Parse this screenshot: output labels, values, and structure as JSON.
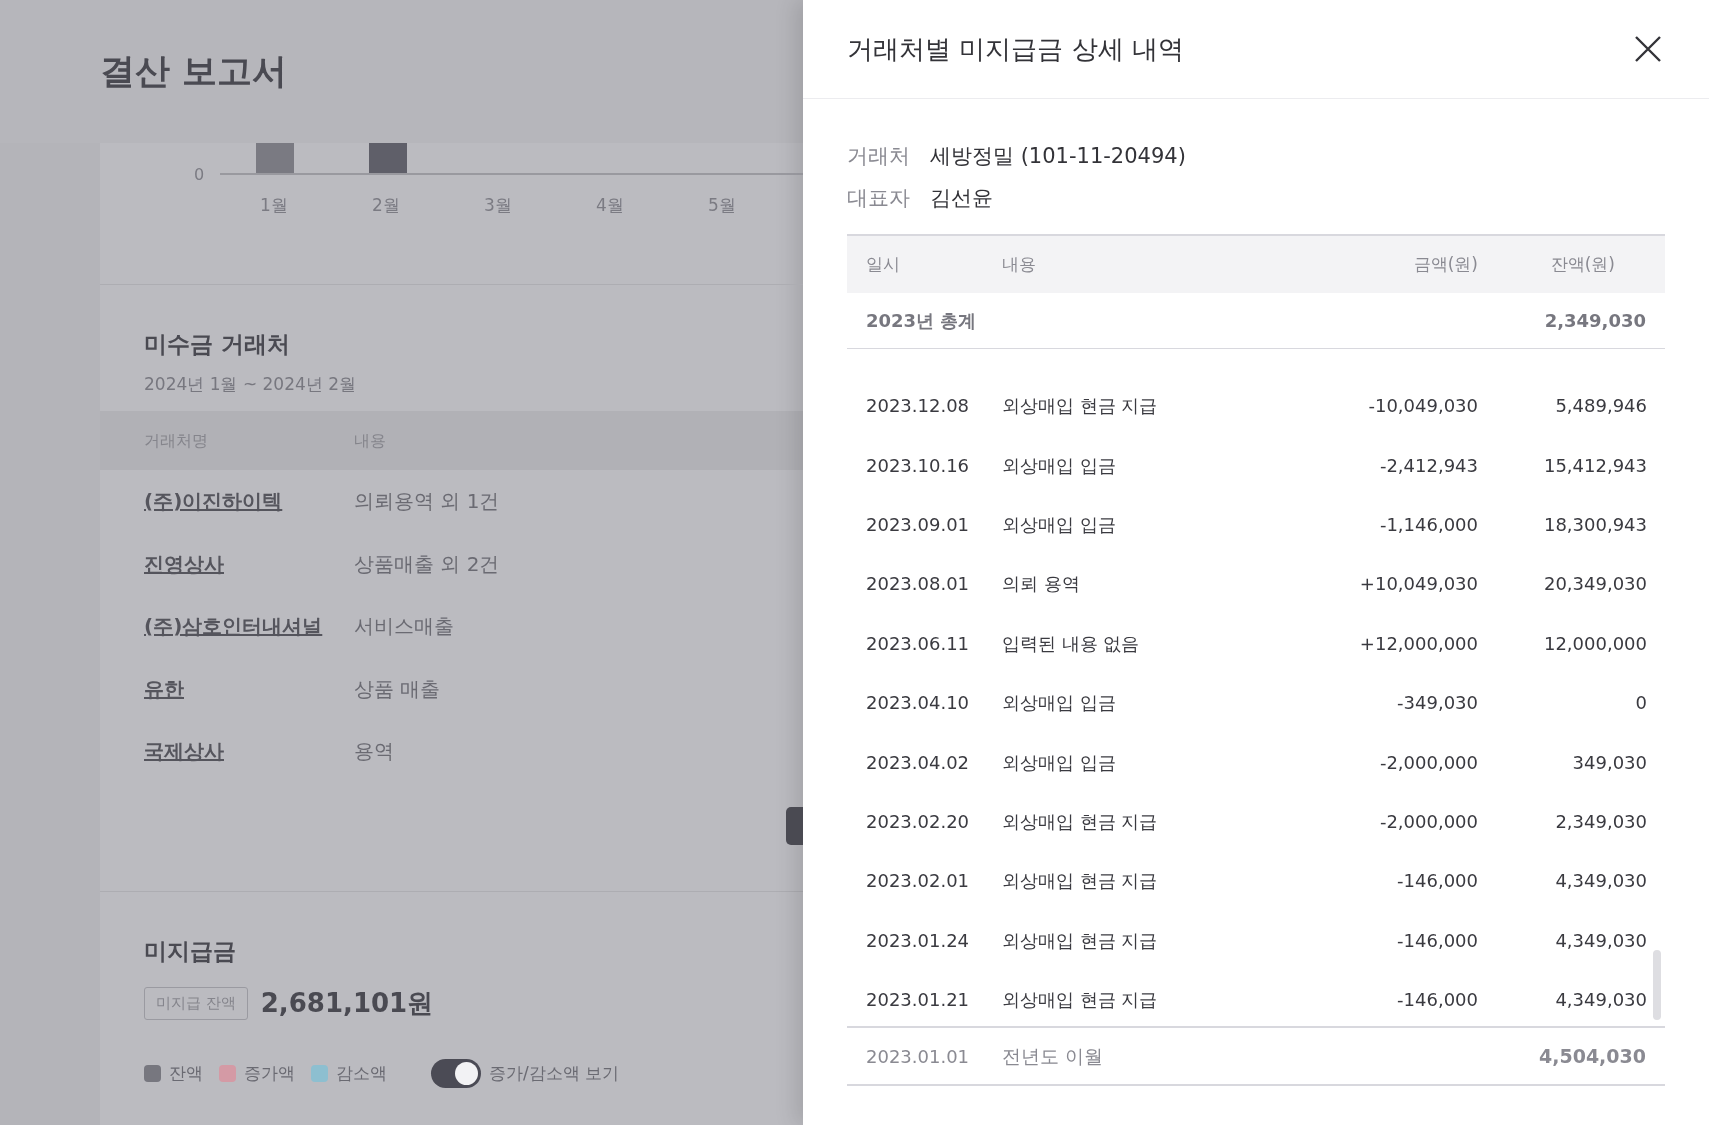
{
  "page": {
    "title": "결산 보고서"
  },
  "chart_axis": {
    "zero_label": "0",
    "months": [
      "1월",
      "2월",
      "3월",
      "4월",
      "5월"
    ]
  },
  "receivables": {
    "title": "미수금 거래처",
    "period": "2024년 1월 ~ 2024년 2월",
    "columns": [
      "거래처명",
      "내용"
    ],
    "rows": [
      {
        "name": "(주)이진하이텍",
        "content": "의뢰용역 외 1건"
      },
      {
        "name": "진영상사",
        "content": "상품매출 외 2건"
      },
      {
        "name": "(주)삼호인터내셔널",
        "content": "서비스매출"
      },
      {
        "name": "유한",
        "content": "상품 매출"
      },
      {
        "name": "국제상사",
        "content": "용역"
      }
    ]
  },
  "payables": {
    "title": "미지급금",
    "balance_label": "미지급 잔액",
    "balance": "2,681,101원",
    "legend": [
      {
        "label": "잔액",
        "color": "#77777f"
      },
      {
        "label": "증가액",
        "color": "#d49aa5"
      },
      {
        "label": "감소액",
        "color": "#8dbfd0"
      }
    ],
    "toggle": {
      "label": "증가/감소액 보기",
      "on": true
    }
  },
  "drawer": {
    "title": "거래처별 미지급금 상세 내역",
    "info": [
      {
        "label": "거래처",
        "value": "세방정밀 (101-11-20494)"
      },
      {
        "label": "대표자",
        "value": "김선윤"
      }
    ],
    "columns": [
      "일시",
      "내용",
      "금액(원)",
      "잔액(원)"
    ],
    "summary": {
      "label": "2023년 총계",
      "balance": "2,349,030"
    },
    "rows": [
      {
        "date": "2023.12.08",
        "content": "외상매입 현금 지급",
        "amount": "-10,049,030",
        "balance": "5,489,946"
      },
      {
        "date": "2023.10.16",
        "content": "외상매입 입금",
        "amount": "-2,412,943",
        "balance": "15,412,943"
      },
      {
        "date": "2023.09.01",
        "content": "외상매입 입금",
        "amount": "-1,146,000",
        "balance": "18,300,943"
      },
      {
        "date": "2023.08.01",
        "content": "의뢰 용역",
        "amount": "+10,049,030",
        "balance": "20,349,030"
      },
      {
        "date": "2023.06.11",
        "content": "입력된 내용 없음",
        "amount": "+12,000,000",
        "balance": "12,000,000"
      },
      {
        "date": "2023.04.10",
        "content": "외상매입 입금",
        "amount": "-349,030",
        "balance": "0"
      },
      {
        "date": "2023.04.02",
        "content": "외상매입 입금",
        "amount": "-2,000,000",
        "balance": "349,030"
      },
      {
        "date": "2023.02.20",
        "content": "외상매입 현금 지급",
        "amount": "-2,000,000",
        "balance": "2,349,030"
      },
      {
        "date": "2023.02.01",
        "content": "외상매입 현금 지급",
        "amount": "-146,000",
        "balance": "4,349,030"
      },
      {
        "date": "2023.01.24",
        "content": "외상매입 현금 지급",
        "amount": "-146,000",
        "balance": "4,349,030"
      },
      {
        "date": "2023.01.21",
        "content": "외상매입 현금 지급",
        "amount": "-146,000",
        "balance": "4,349,030"
      }
    ],
    "carryover": {
      "date": "2023.01.01",
      "content": "전년도 이월",
      "balance": "4,504,030"
    }
  }
}
